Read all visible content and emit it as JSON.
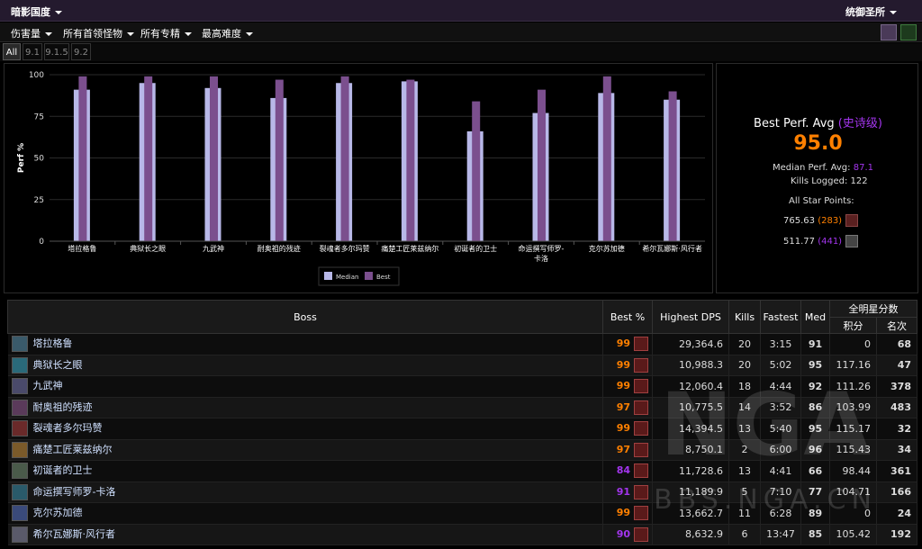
{
  "topbar": {
    "raid": "暗影国度",
    "server": "统御圣所"
  },
  "filters": [
    "伤害量",
    "所有首领怪物",
    "所有专精",
    "最高难度"
  ],
  "patches": [
    "All",
    "9.1",
    "9.1.5",
    "9.2"
  ],
  "colors": {
    "median_bar": "#b8b8e8",
    "best_bar": "#7b4f8e",
    "legendary": "#ff8000",
    "epic": "#a335ee",
    "rare": "#0070ff"
  },
  "chart_data": {
    "type": "bar",
    "ylabel": "Perf %",
    "ylim": [
      0,
      100
    ],
    "yticks": [
      0,
      25,
      50,
      75,
      100
    ],
    "categories": [
      "塔拉格鲁",
      "典狱长之眼",
      "九武神",
      "耐奥祖的残迹",
      "裂魂者多尔玛赞",
      "痛楚工匠莱兹纳尔",
      "初诞者的卫士",
      "命运撰写师罗-\n卡洛",
      "克尔苏加德",
      "希尔瓦娜斯·风行者"
    ],
    "series": [
      {
        "name": "Median",
        "values": [
          91,
          95,
          92,
          86,
          95,
          96,
          66,
          77,
          89,
          85
        ]
      },
      {
        "name": "Best",
        "values": [
          99,
          99,
          99,
          97,
          99,
          97,
          84,
          91,
          99,
          90
        ]
      }
    ],
    "legend": "bottom"
  },
  "summary": {
    "title": "Best Perf. Avg",
    "title_tier": "(史诗级)",
    "best_avg": "95.0",
    "median_label": "Median Perf. Avg:",
    "median_value": "87.1",
    "kills_label": "Kills Logged:",
    "kills_value": "122",
    "star_label": "All Star Points:",
    "star1_points": "765.63",
    "star1_rank": "(283)",
    "star2_points": "511.77",
    "star2_rank": "(441)"
  },
  "table": {
    "headers": {
      "boss": "Boss",
      "best": "Best %",
      "dps": "Highest DPS",
      "kills": "Kills",
      "fastest": "Fastest",
      "med": "Med",
      "allstar": "全明星分数",
      "points": "积分",
      "rank": "名次"
    },
    "rows": [
      {
        "boss": "塔拉格鲁",
        "best": "99",
        "dps": "29,364.6",
        "kills": "20",
        "fastest": "3:15",
        "med": "91",
        "points": "0",
        "rank": "68",
        "best_tier": "leg",
        "med_tier": "epic",
        "icon_color": "#3a5a6a"
      },
      {
        "boss": "典狱长之眼",
        "best": "99",
        "dps": "10,988.3",
        "kills": "20",
        "fastest": "5:02",
        "med": "95",
        "points": "117.16",
        "rank": "47",
        "best_tier": "leg",
        "med_tier": "leg",
        "icon_color": "#2a6a7a"
      },
      {
        "boss": "九武神",
        "best": "99",
        "dps": "12,060.4",
        "kills": "18",
        "fastest": "4:44",
        "med": "92",
        "points": "111.26",
        "rank": "378",
        "best_tier": "leg",
        "med_tier": "epic",
        "icon_color": "#4a4a6a"
      },
      {
        "boss": "耐奥祖的残迹",
        "best": "97",
        "dps": "10,775.5",
        "kills": "14",
        "fastest": "3:52",
        "med": "86",
        "points": "103.99",
        "rank": "483",
        "best_tier": "leg",
        "med_tier": "epic",
        "icon_color": "#5a3a5a"
      },
      {
        "boss": "裂魂者多尔玛赞",
        "best": "99",
        "dps": "14,394.5",
        "kills": "13",
        "fastest": "5:40",
        "med": "95",
        "points": "115.17",
        "rank": "32",
        "best_tier": "leg",
        "med_tier": "leg",
        "icon_color": "#6a2a2a"
      },
      {
        "boss": "痛楚工匠莱兹纳尔",
        "best": "97",
        "dps": "8,750.1",
        "kills": "2",
        "fastest": "6:00",
        "med": "96",
        "points": "115.43",
        "rank": "34",
        "best_tier": "leg",
        "med_tier": "leg",
        "icon_color": "#7a5a2a"
      },
      {
        "boss": "初诞者的卫士",
        "best": "84",
        "dps": "11,728.6",
        "kills": "13",
        "fastest": "4:41",
        "med": "66",
        "points": "98.44",
        "rank": "361",
        "best_tier": "epic",
        "med_tier": "rare",
        "icon_color": "#4a5a4a"
      },
      {
        "boss": "命运撰写师罗-卡洛",
        "best": "91",
        "dps": "11,189.9",
        "kills": "5",
        "fastest": "7:10",
        "med": "77",
        "points": "104.71",
        "rank": "166",
        "best_tier": "epic",
        "med_tier": "epic",
        "icon_color": "#2a5a6a"
      },
      {
        "boss": "克尔苏加德",
        "best": "99",
        "dps": "13,662.7",
        "kills": "11",
        "fastest": "6:28",
        "med": "89",
        "points": "0",
        "rank": "24",
        "best_tier": "leg",
        "med_tier": "epic",
        "icon_color": "#3a4a7a"
      },
      {
        "boss": "希尔瓦娜斯·风行者",
        "best": "90",
        "dps": "8,632.9",
        "kills": "6",
        "fastest": "13:47",
        "med": "85",
        "points": "105.42",
        "rank": "192",
        "best_tier": "epic",
        "med_tier": "epic",
        "icon_color": "#5a5a6a"
      }
    ]
  },
  "watermark": {
    "big": "NGA",
    "url": "BBS.NGA.CN"
  }
}
